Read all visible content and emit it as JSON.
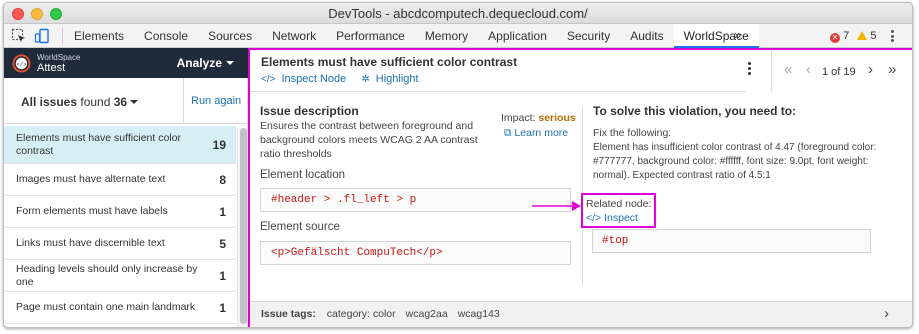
{
  "window": {
    "title": "DevTools - abcdcomputech.dequecloud.com/"
  },
  "devtools_tabs": [
    "Elements",
    "Console",
    "Sources",
    "Network",
    "Performance",
    "Memory",
    "Application",
    "Security",
    "Audits",
    "WorldSpace"
  ],
  "active_tab": "WorldSpace",
  "overflow": "»",
  "status": {
    "errors": "7",
    "warnings": "5"
  },
  "sidebar": {
    "brand_top": "WorldSpace",
    "brand_name": "Attest",
    "analyze": "Analyze",
    "all_issues_label": "All issues",
    "found_label": "found",
    "found_count": "36",
    "run_again": "Run again",
    "issues": [
      {
        "name": "Elements must have sufficient color contrast",
        "count": "19"
      },
      {
        "name": "Images must have alternate text",
        "count": "8"
      },
      {
        "name": "Form elements must have labels",
        "count": "1"
      },
      {
        "name": "Links must have discernible text",
        "count": "5"
      },
      {
        "name": "Heading levels should only increase by one",
        "count": "1"
      },
      {
        "name": "Page must contain one main landmark",
        "count": "1"
      }
    ]
  },
  "issue": {
    "title": "Elements must have sufficient color contrast",
    "inspect_node": "Inspect Node",
    "highlight": "Highlight",
    "pager": {
      "first": "«",
      "prev": "‹",
      "text": "1 of 19",
      "next": "›",
      "last": "»"
    },
    "description_title": "Issue description",
    "description": "Ensures the contrast between foreground and background colors meets WCAG 2 AA contrast ratio thresholds",
    "impact_label": "Impact:",
    "impact_value": "serious",
    "learn_more": "Learn more",
    "element_location_label": "Element location",
    "element_location": "#header > .fl_left > p",
    "element_source_label": "Element source",
    "element_source": "<p>Gefälscht CompuTech</p>",
    "solve_title": "To solve this violation, you need to:",
    "fix_title": "Fix the following:",
    "fix_text": "Element has insufficient color contrast of 4.47 (foreground color: #777777, background color: #ffffff, font size: 9.0pt, font weight: normal). Expected contrast ratio of 4.5:1",
    "related_label": "Related node:",
    "related_inspect": "Inspect",
    "related_node": "#top"
  },
  "tags": {
    "label": "Issue tags:",
    "items": [
      "category: color",
      "wcag2aa",
      "wcag143"
    ]
  },
  "colors": {
    "highlight": "#e100d5",
    "link": "#1a6fb0",
    "selected_row": "#d6eff5",
    "brand_bar": "#1f2a3a",
    "code_text": "#c41a16"
  },
  "icons": [
    "inspect-element-icon",
    "device-toggle-icon",
    "error-icon",
    "warning-icon",
    "kebab-menu-icon",
    "worldspace-logo-icon",
    "code-icon",
    "highlight-icon",
    "external-link-icon",
    "chevron-right-icon"
  ]
}
